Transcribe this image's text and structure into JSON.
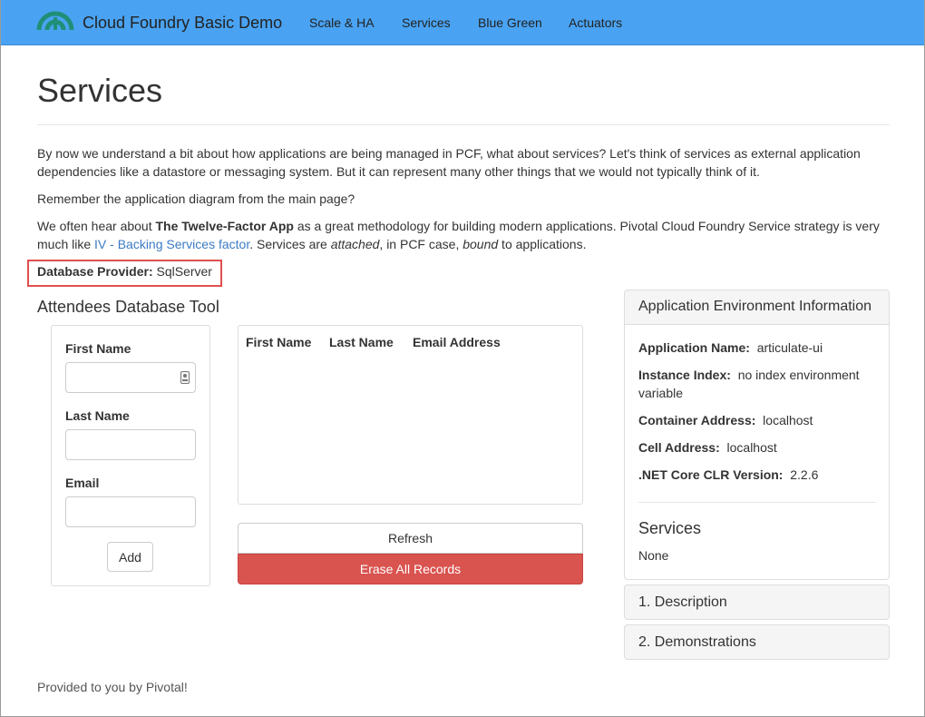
{
  "navbar": {
    "brand": "Cloud Foundry Basic Demo",
    "links": [
      "Scale & HA",
      "Services",
      "Blue Green",
      "Actuators"
    ]
  },
  "page": {
    "title": "Services",
    "para1": "By now we understand a bit about how applications are being managed in PCF, what about services? Let's think of services as external application dependencies like a datastore or messaging system. But it can represent many other things that we would not typically think of it.",
    "para2": "Remember the application diagram from the main page?",
    "para3": {
      "text_before": "We often hear about ",
      "bold": "The Twelve-Factor App",
      "text_mid": " as a great methodology for building modern applications. Pivotal Cloud Foundry Service strategy is very much like ",
      "link": "IV - Backing Services factor",
      "text_after1": ". Services are ",
      "em1": "attached",
      "text_after2": ", in PCF case, ",
      "em2": "bound",
      "text_after3": " to applications."
    },
    "provider": {
      "label": "Database Provider:",
      "value": "SqlServer"
    }
  },
  "tool": {
    "title": "Attendees Database Tool",
    "form": {
      "first_name_label": "First Name",
      "last_name_label": "Last Name",
      "email_label": "Email",
      "first_name_value": "",
      "last_name_value": "",
      "email_value": "",
      "add_label": "Add"
    },
    "table": {
      "columns": [
        "First Name",
        "Last Name",
        "Email Address"
      ],
      "rows": []
    },
    "refresh_label": "Refresh",
    "erase_label": "Erase All Records"
  },
  "env": {
    "heading": "Application Environment Information",
    "items": [
      {
        "label": "Application Name:",
        "value": "articulate-ui"
      },
      {
        "label": "Instance Index:",
        "value": "no index environment variable"
      },
      {
        "label": "Container Address:",
        "value": "localhost"
      },
      {
        "label": "Cell Address:",
        "value": "localhost"
      },
      {
        "label": ".NET Core CLR Version:",
        "value": "2.2.6"
      }
    ],
    "services_title": "Services",
    "services_value": "None"
  },
  "accordion": [
    "1. Description",
    "2. Demonstrations"
  ],
  "footer": "Provided to you by Pivotal!",
  "colors": {
    "navbar": "#4aa3f2",
    "danger": "#d9534f",
    "link": "#3b7bc4",
    "highlight": "#e04f4f"
  }
}
